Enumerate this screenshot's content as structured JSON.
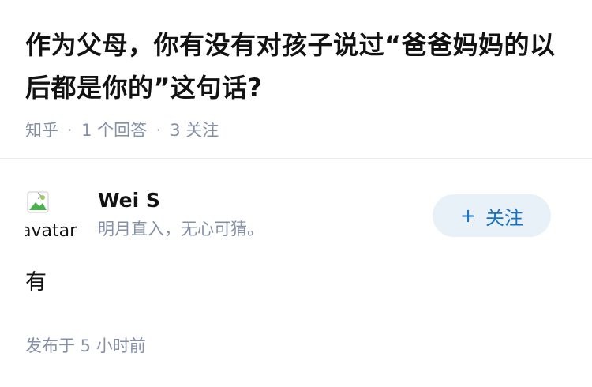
{
  "question": {
    "title": "作为父母，你有没有对孩子说过“爸爸妈妈的以后都是你的”这句话?",
    "source": "知乎",
    "separator": "·",
    "answer_count": "1 个回答",
    "follower_count": "3 关注"
  },
  "answer": {
    "author": {
      "avatar_alt": "avatar",
      "name": "Wei S",
      "bio": "明月直入，无心可猜。"
    },
    "follow_button": {
      "icon": "+",
      "label": "关注"
    },
    "content": "有",
    "published_time": "发布于 5 小时前"
  },
  "colors": {
    "text_primary": "#121212",
    "text_secondary": "#8590a6",
    "accent": "#1772c6",
    "button_bg": "#e8f0f8",
    "divider": "#ebebeb"
  }
}
